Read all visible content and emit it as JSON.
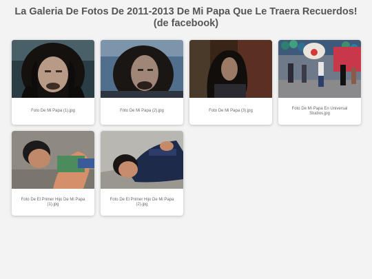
{
  "page": {
    "title": "La Galeria De Fotos De 2011-2013 De Mi Papa Que Le Traera Recuerdos! (de facebook)"
  },
  "photos": [
    {
      "caption": "Foto De Mi Papa (1).jpg"
    },
    {
      "caption": "Foto De Mi Papa (2).jpg"
    },
    {
      "caption": "Foto De Mi Papa (3).jpg"
    },
    {
      "caption": "Foto De Mi Papa En Universal Studios.jpg"
    },
    {
      "caption": "Foto De El Primer Hijo De Mi Papa (1).jpg"
    },
    {
      "caption": "Foto De El Primer Hijo De Mi Papa (2).jpg"
    }
  ]
}
